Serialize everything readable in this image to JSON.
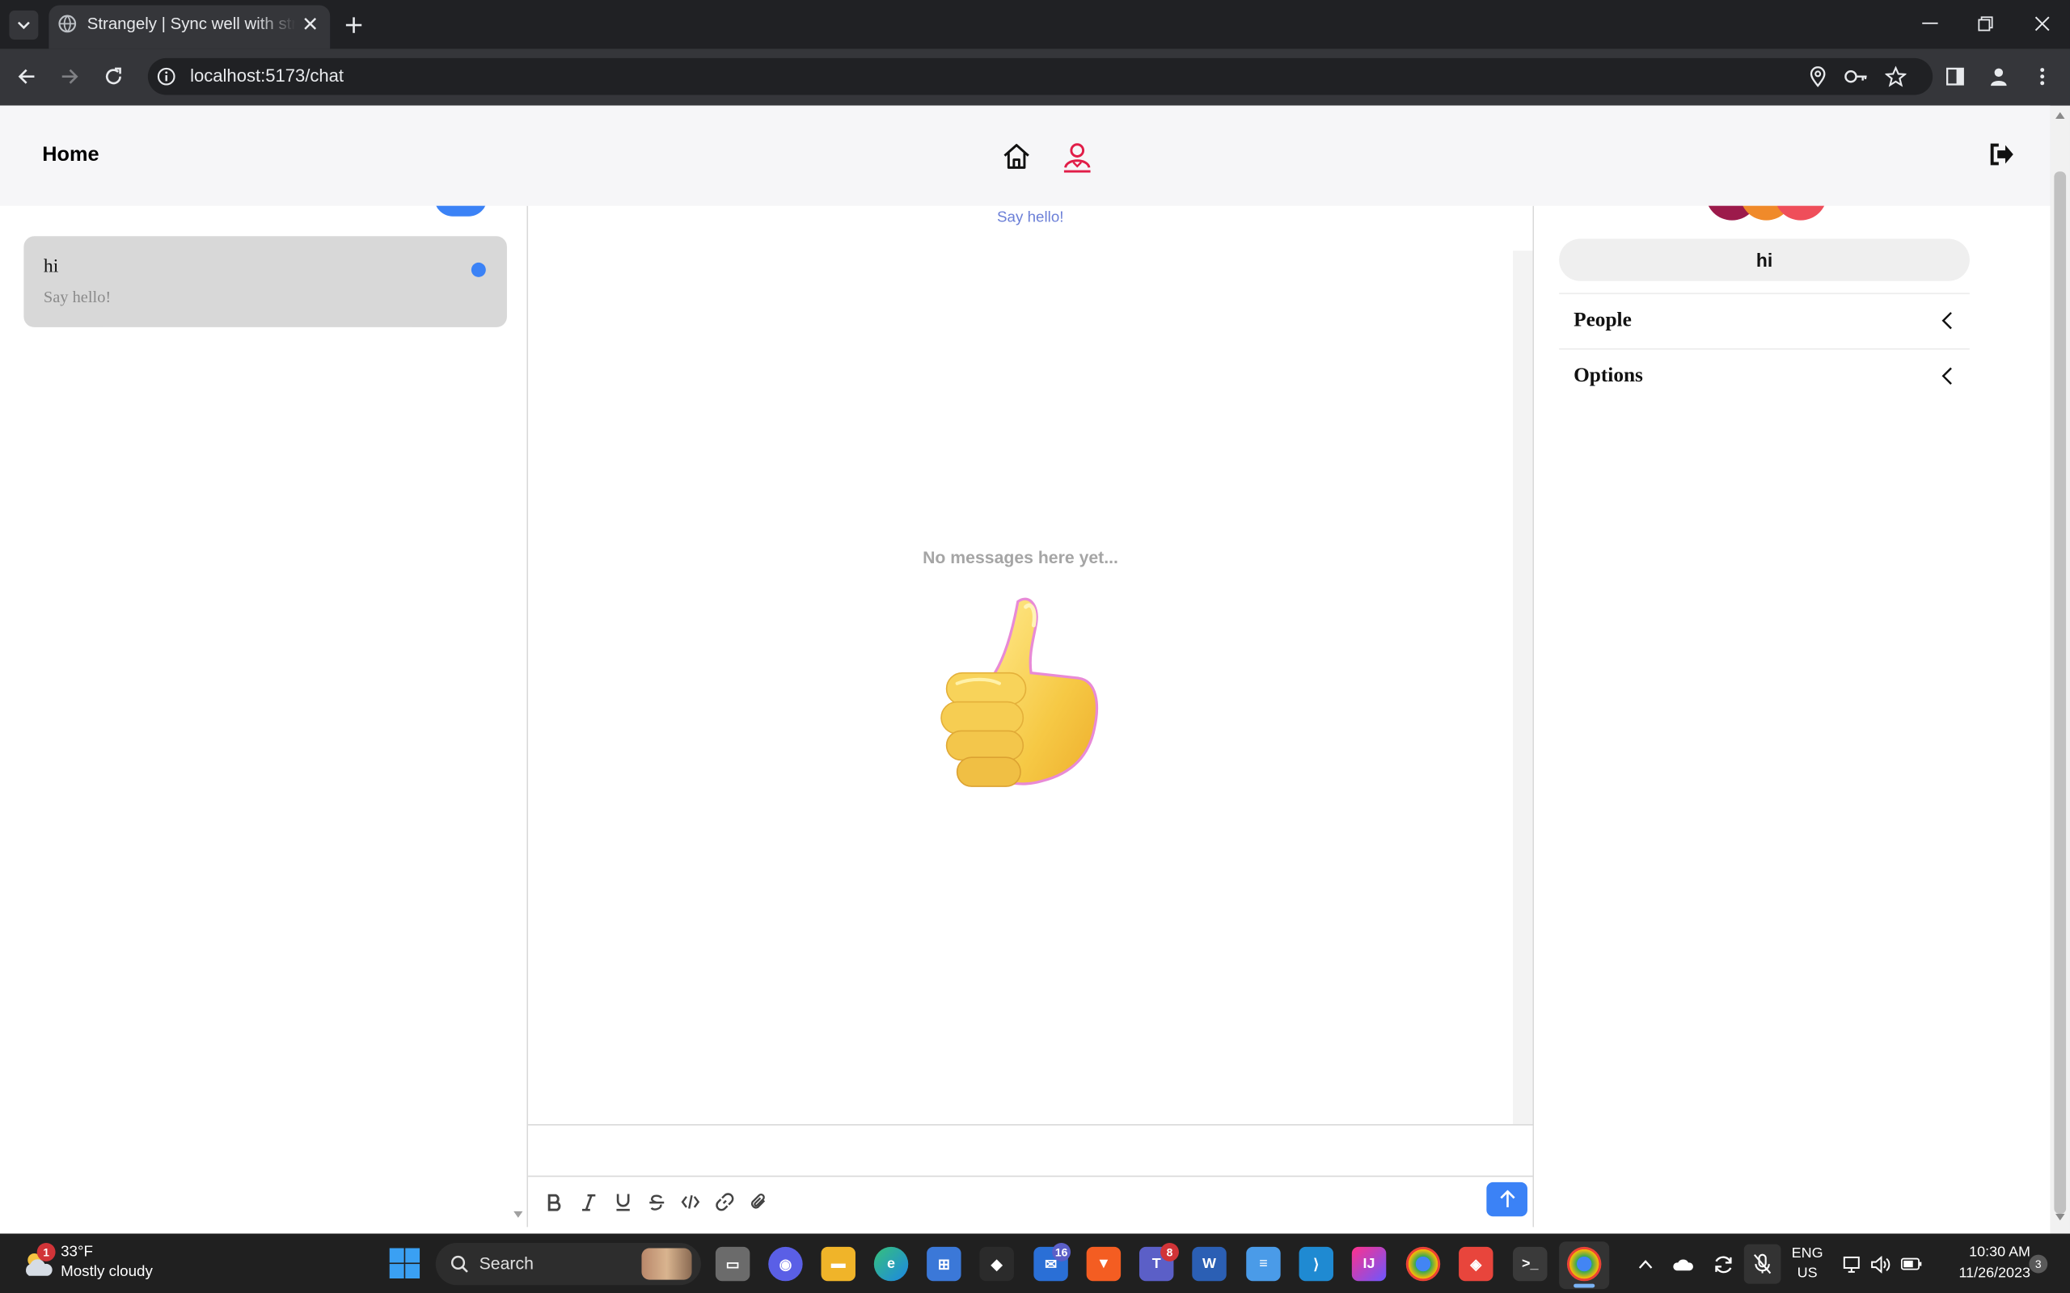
{
  "browser": {
    "tab_title": "Strangely | Sync well with strangers",
    "url": "localhost:5173/chat"
  },
  "app": {
    "header_title": "Home",
    "conversations": [
      {
        "name": "hi",
        "preview": "Say hello!",
        "unread": true
      }
    ],
    "chat": {
      "top_preview": "Say hello!",
      "empty_text": "No messages here yet...",
      "input_value": ""
    },
    "details": {
      "group_name": "hi",
      "sections": [
        "People",
        "Options"
      ]
    },
    "colors": {
      "accent": "#3b82f6",
      "active_nav": "#e11d48"
    }
  },
  "taskbar": {
    "weather_temp": "33°F",
    "weather_condition": "Mostly cloudy",
    "weather_badge": "1",
    "search_label": "Search",
    "teams_badge": "16",
    "chat_badge": "8",
    "lang_line1": "ENG",
    "lang_line2": "US",
    "time": "10:30 AM",
    "date": "11/26/2023",
    "notification_count": "3"
  }
}
